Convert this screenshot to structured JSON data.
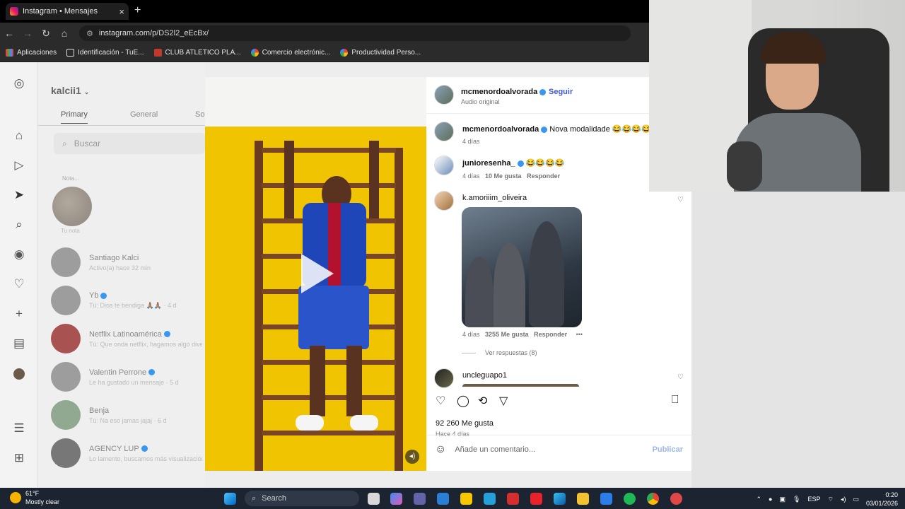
{
  "browser": {
    "tab_title": "Instagram • Mensajes",
    "url": "instagram.com/p/DS2l2_eEcBx/",
    "bookmarks": [
      "Aplicaciones",
      "Identificación - TuE...",
      "CLUB ATLETICO PLA...",
      "Comercio electrónic...",
      "Productividad Perso..."
    ]
  },
  "dm": {
    "username": "kalcii1",
    "tabs": [
      "Primary",
      "General",
      "Sol"
    ],
    "search_placeholder": "Buscar",
    "note_label": "Nota...",
    "note_sub": "Tu nota",
    "conversations": [
      {
        "name": "Santiago Kalci",
        "sub": "Activo(a) hace 32 min"
      },
      {
        "name": "Yb",
        "sub": "Tú: Dios te bendiga 🙏🏽🙏🏽 · 4 d"
      },
      {
        "name": "Netflix Latinoamérica",
        "sub": "Tú: Que onda netflix, hagamos algo divers"
      },
      {
        "name": "Valentin Perrone",
        "sub": "Le ha gustado un mensaje · 5 d"
      },
      {
        "name": "Benja",
        "sub": "Tú: Na eso jamas jajaj · 6 d"
      },
      {
        "name": "AGENCY LUP",
        "sub": "Lo lamento, buscamos más visualización..."
      }
    ]
  },
  "post": {
    "author": "mcmenordoalvorada",
    "follow_label": "Seguir",
    "audio": "Audio original",
    "caption_user": "mcmenordoalvorada",
    "caption_text": "Nova modalidade 😂😂😂😂",
    "caption_age": "4 días",
    "comments": [
      {
        "user": "junioresenha_",
        "text": "😂😂😂😂",
        "age": "4 días",
        "likes": "10 Me gusta",
        "reply": "Responder"
      },
      {
        "user": "k.amoriiim_oliveira",
        "text": "",
        "age": "4 días",
        "likes": "3255 Me gusta",
        "reply": "Responder",
        "replies": "Ver respuestas (8)"
      },
      {
        "user": "uncleguapo1",
        "text": "",
        "age": "",
        "likes": "",
        "reply": ""
      }
    ],
    "likes": "92 260 Me gusta",
    "age": "Hace 4 días",
    "comment_placeholder": "Añade un comentario...",
    "publish_label": "Publicar"
  },
  "taskbar": {
    "temp": "61°F",
    "weather": "Mostly clear",
    "search": "Search",
    "lang": "ESP",
    "time": "0:20",
    "date": "03/01/2026"
  },
  "colors": {
    "accent": "#3b5bdb",
    "verified": "#3897f0",
    "video_bg": "#f0c400"
  }
}
